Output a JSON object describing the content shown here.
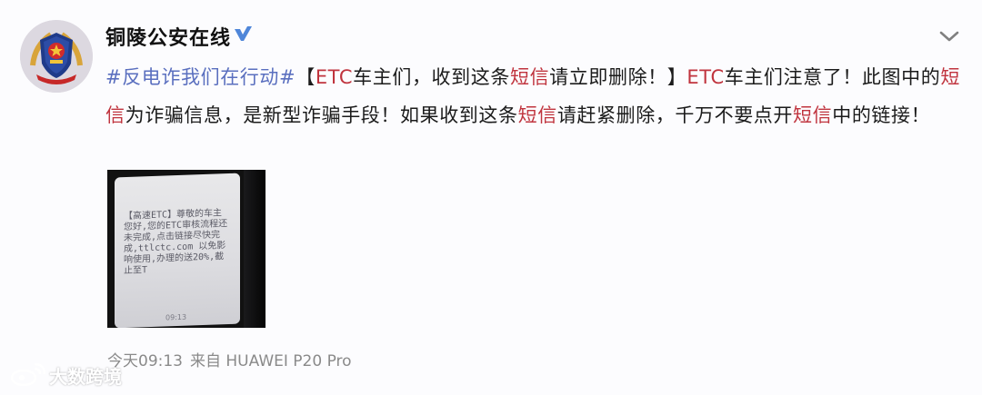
{
  "user": {
    "name": "铜陵公安在线"
  },
  "post": {
    "topic": "#反电诈我们在行动#",
    "segments": [
      {
        "text": "【",
        "style": "plain"
      },
      {
        "text": "ETC",
        "style": "kw"
      },
      {
        "text": "车主们，收到这条",
        "style": "plain"
      },
      {
        "text": "短信",
        "style": "kw"
      },
      {
        "text": "请立即删除！】",
        "style": "plain"
      },
      {
        "text": "ETC",
        "style": "kw"
      },
      {
        "text": "车主们注意了！此图中的",
        "style": "plain"
      },
      {
        "text": "短信",
        "style": "kw"
      },
      {
        "text": "为诈骗信息，是新型诈骗手段！如果收到这条",
        "style": "plain"
      },
      {
        "text": "短信",
        "style": "kw"
      },
      {
        "text": "请赶紧删除，千万不要点开",
        "style": "plain"
      },
      {
        "text": "短信",
        "style": "kw"
      },
      {
        "text": "中的链接！",
        "style": "plain"
      }
    ]
  },
  "image": {
    "sms_text": "【高速ETC】尊敬的车主您好,您的ETC审核流程还未完成,点击链接尽快完成,ttlctc.com 以免影响使用,办理的送20%,截止至T",
    "sms_time": "09:13"
  },
  "meta": {
    "time": "今天09:13",
    "source": "来自 HUAWEI P20 Pro"
  },
  "watermark": {
    "text": "大数跨境"
  },
  "colors": {
    "keyword": "#c0343e",
    "topic": "#5a6fbf",
    "verified": "#f4a32a"
  }
}
